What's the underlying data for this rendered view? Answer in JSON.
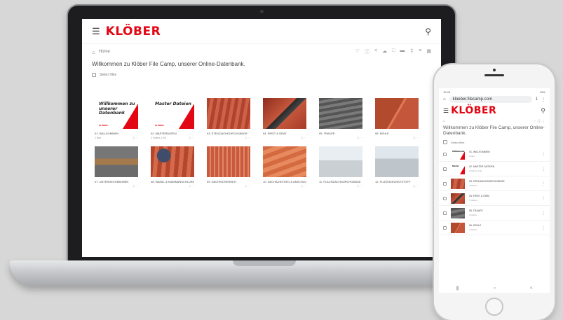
{
  "desktop": {
    "brand": "KLÖBER",
    "menu_icon": "menu-icon",
    "search_icon": "search-icon",
    "breadcrumb": "Home",
    "welcome": "Willkommen zu Klöber File Camp, unserer Online-Datenbank.",
    "select_files": "Select files",
    "toolbar_icons": [
      "heart-icon",
      "info-icon",
      "share-icon",
      "cloud-upload-icon",
      "folder-icon",
      "delete-icon",
      "download-icon",
      "sort-icon",
      "grid-icon"
    ],
    "folders": [
      {
        "name": "01. WILLKOMMEN",
        "meta": "2 files",
        "thumb": "text",
        "thumb_text": "Willkommen zu unserer Datenbank",
        "thumb_mini": "KLÖBER"
      },
      {
        "name": "02. MASTERDATEN",
        "meta": "3 folders 1 file",
        "thumb": "text",
        "thumb_text": "Master Dateien",
        "thumb_mini": "KLÖBER"
      },
      {
        "name": "03. STEILDACHDURCHGÄNGE",
        "meta": "",
        "thumb": "redroof"
      },
      {
        "name": "04. FIRST & GRAT",
        "meta": "",
        "thumb": "ridge"
      },
      {
        "name": "05. TRAUFE",
        "meta": "",
        "thumb": "grey"
      },
      {
        "name": "06. KEHLE",
        "meta": "",
        "thumb": "valley"
      },
      {
        "name": "07. UNTERDECKBAHNEN",
        "meta": "",
        "thumb": "wood"
      },
      {
        "name": "08. WAND- & KAMINANSCHLÜSSE",
        "meta": "",
        "thumb": "worker"
      },
      {
        "name": "09. DACHSICHERHEIT",
        "meta": "",
        "thumb": "lad"
      },
      {
        "name": "10. DACHAUSSTIEG & ANSCHLÜSSE",
        "meta": "",
        "thumb": "orange"
      },
      {
        "name": "11. FLACHDACHDURCHGÄNGE",
        "meta": "",
        "thumb": "flat"
      },
      {
        "name": "12. FLÜSSIGKUNSTSTOFF",
        "meta": "",
        "thumb": "flat2"
      }
    ]
  },
  "mobile": {
    "status_left": "12:46",
    "status_right": "45%",
    "url": "kloeber.filecamp.com",
    "tabs_count": "1",
    "brand": "KLÖBER",
    "welcome": "Willkommen zu Klöber File Camp, unserer Online-Datenbank.",
    "select_files": "Select files",
    "rows": [
      {
        "name": "01. WILLKOMMEN",
        "meta": "2 files",
        "thumb": "text",
        "thumb_text": "Willkommen"
      },
      {
        "name": "02. MASTER DATEIEN",
        "meta": "3 folders 1 file",
        "thumb": "text",
        "thumb_text": "Master"
      },
      {
        "name": "03. STEILDACHDURCHGÄNGE",
        "meta": "4 folders",
        "thumb": "redroof"
      },
      {
        "name": "04. FIRST & GRAT",
        "meta": "7 folders",
        "thumb": "ridge"
      },
      {
        "name": "05. TRAUFE",
        "meta": "3 folders",
        "thumb": "grey"
      },
      {
        "name": "06. KEHLE",
        "meta": "4 folders",
        "thumb": "valley"
      }
    ],
    "nav": [
      "|||",
      "○",
      "<"
    ]
  }
}
